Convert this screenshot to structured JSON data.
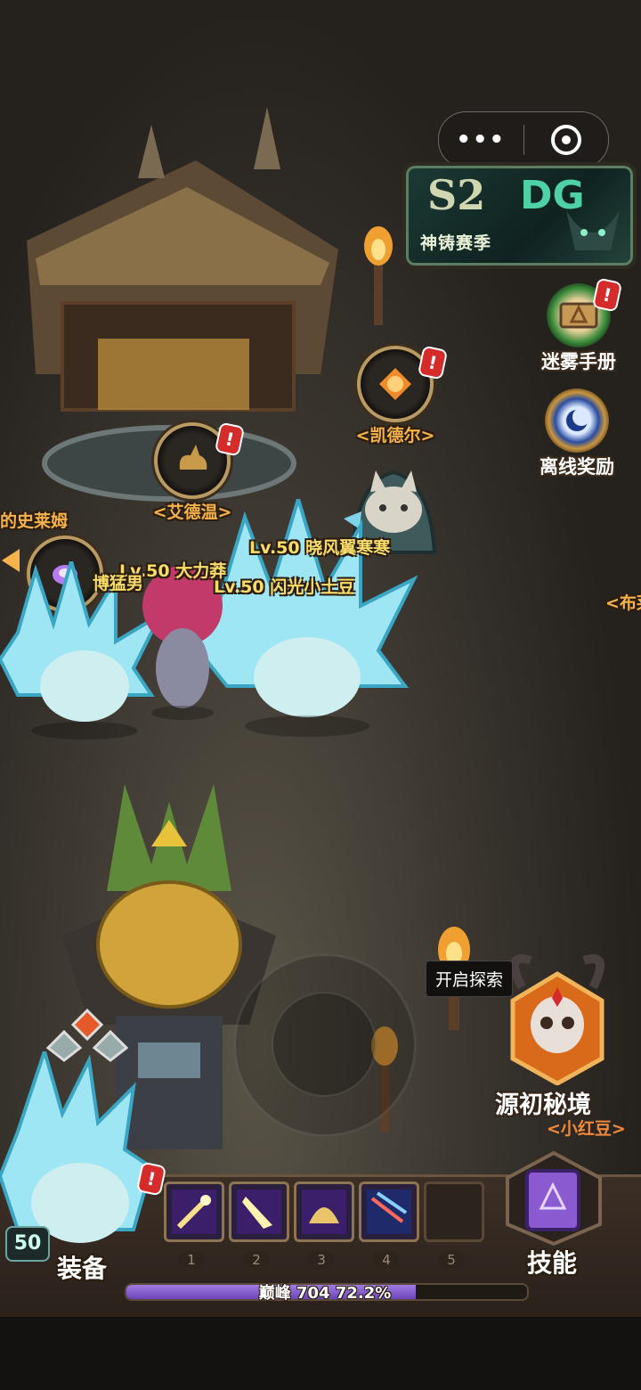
{
  "hud": {
    "season": {
      "badge": "S2",
      "logo": "DG",
      "label": "神铸赛季"
    },
    "side_menu": [
      {
        "label": "迷雾手册",
        "icon": "book-rune-icon",
        "alert": "!"
      },
      {
        "label": "离线奖励",
        "icon": "moon-sun-icon"
      }
    ]
  },
  "npcs": [
    {
      "name": "<凯德尔>",
      "icon": "sun-amber-icon",
      "alert": "!"
    },
    {
      "name": "<艾德温>",
      "icon": "rabbit-icon",
      "alert": "!"
    },
    {
      "name": "的史莱姆",
      "icon": "purple-orb-icon"
    },
    {
      "name": "<布莱"
    }
  ],
  "players": [
    {
      "label": "Lv.50 晓风翼寒寒"
    },
    {
      "label": "Lv.50 大力莽"
    },
    {
      "label": "Lv.50 闪光小土豆"
    },
    {
      "label": "博猛男"
    }
  ],
  "explore": {
    "tooltip": "开启探索",
    "dungeon_label": "源初秘境",
    "dungeon_sub": "<小红豆>"
  },
  "bottom": {
    "level": "50",
    "equip_label": "装备",
    "equip_alert": "!",
    "skills_label": "技能",
    "skill_slots": [
      {
        "num": "1",
        "icon": "comet-skill-icon"
      },
      {
        "num": "2",
        "icon": "light-beam-skill-icon"
      },
      {
        "num": "3",
        "icon": "dome-shield-skill-icon"
      },
      {
        "num": "4",
        "icon": "meteor-shower-skill-icon"
      },
      {
        "num": "5",
        "icon": ""
      }
    ],
    "xp": {
      "label": "巅峰 704",
      "percent": "72.2%",
      "fraction": 0.722
    }
  },
  "colors": {
    "accent_gold": "#f5b34a",
    "xp_purple": "#8e62d3",
    "alert_red": "#d62b2b"
  }
}
